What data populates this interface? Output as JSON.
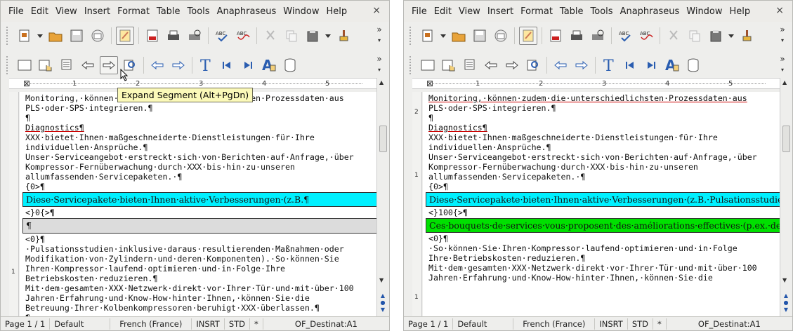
{
  "menu": [
    "File",
    "Edit",
    "View",
    "Insert",
    "Format",
    "Table",
    "Tools",
    "Anaphraseus",
    "Window",
    "Help"
  ],
  "close_glyph": "×",
  "toolbar1_icons": [
    "document-icon",
    "open-folder-icon",
    "save-icon",
    "email-icon",
    "edit-mode-icon",
    "export-pdf-icon",
    "print-icon",
    "print-preview-icon",
    "spellcheck-icon",
    "autospellcheck-icon",
    "cut-icon",
    "copy-icon",
    "paste-icon",
    "format-paintbrush-icon"
  ],
  "toolbar2_icons": [
    "setup-icon",
    "translate-segment-icon",
    "glossary-icon",
    "close-segment-icon",
    "expand-segment-icon",
    "search-icon",
    "prev-icon",
    "next-icon",
    "text-tool-icon",
    "first-segment-icon",
    "last-segment-icon",
    "concordance-icon",
    "database-icon"
  ],
  "tooltip": "Expand Segment (Alt+PgDn)",
  "ruler_numbers": [
    "1",
    "2",
    "3",
    "4",
    "5"
  ],
  "vruler_numbers_w1": [
    "1"
  ],
  "vruler_numbers_w2": [
    "2",
    "1",
    "1"
  ],
  "window1": {
    "pre": [
      "Monitoring,·können·zudem·die·unterschiedlichsten·Prozessdaten·aus",
      "PLS·oder·SPS·integrieren.¶",
      "¶",
      "Diagnostics¶",
      "XXX·bietet·Ihnen·maßgeschneiderte·Dienstleistungen·für·Ihre",
      "individuellen·Ansprüche.¶",
      "Unser·Serviceangebot·erstreckt·sich·von·Berichten·auf·Anfrage,·über",
      "Kompressor-Fernüberwachung·durch·XXX·bis·hin·zu·unseren",
      "allumfassenden·Servicepaketen.·¶",
      "{0>¶"
    ],
    "source_segment": "Diese·Servicepakete·bieten·Ihnen·aktive·Verbesserungen·(z.B.¶",
    "mid": "<}0{>¶",
    "target_segment": "¶",
    "post": [
      "<0}¶",
      "·Pulsationsstudien·inklusive·daraus·resultierenden·Maßnahmen·oder",
      "Modifikation·von·Zylindern·und·deren·Komponenten).·So·können·Sie",
      "Ihren·Kompressor·laufend·optimieren·und·in·Folge·Ihre",
      "Betriebskosten·reduzieren.¶",
      "Mit·dem·gesamten·XXX·Netzwerk·direkt·vor·Ihrer·Tür·und·mit·über·100",
      "Jahren·Erfahrung·und·Know-How·hinter·Ihnen,·können·Sie·die",
      "Betreuung·Ihrer·Kolbenkompressoren·beruhigt·XXX·überlassen.¶",
      "¶"
    ]
  },
  "window2": {
    "pre": [
      "Monitoring,·können·zudem·die·unterschiedlichsten·Prozessdaten·aus",
      "PLS·oder·SPS·integrieren.¶",
      "¶",
      "Diagnostics¶",
      "XXX·bietet·Ihnen·maßgeschneiderte·Dienstleistungen·für·Ihre",
      "individuellen·Ansprüche.¶",
      "Unser·Serviceangebot·erstreckt·sich·von·Berichten·auf·Anfrage,·über",
      "Kompressor-Fernüberwachung·durch·XXX·bis·hin·zu·unseren",
      "allumfassenden·Servicepaketen.·¶",
      "{0>¶"
    ],
    "source_segment": "Diese·Servicepakete·bieten·Ihnen·aktive·Verbesserungen·(z.B.·Pulsationsstudien·inklusive·daraus·resultierenden·Maßnahmen·oder·Modifikation·von·Zylindern·und·deren·Komponenten).¶",
    "mid": "<}100{>¶",
    "target_segment": "Ces·bouquets·de·services·vous·proposent·des·améliorations·effectives·(p.ex.·des·études·de·pulsations·suivies·d'actions·concrètes·ou·de·modifications·de·cylindres·et·de·leurs·composants)¶",
    "post": [
      "<0}¶",
      "·So·können·Sie·Ihren·Kompressor·laufend·optimieren·und·in·Folge",
      "Ihre·Betriebskosten·reduzieren.¶",
      "Mit·dem·gesamten·XXX·Netzwerk·direkt·vor·Ihrer·Tür·und·mit·über·100",
      "Jahren·Erfahrung·und·Know-How·hinter·Ihnen,·können·Sie·die"
    ]
  },
  "status": {
    "page": "Page 1 / 1",
    "style": "Default",
    "language": "French (France)",
    "insert": "INSRT",
    "selection": "STD",
    "modified": "*",
    "section": "OF_Destinat:A1"
  },
  "colors": {
    "source_segment": "#00f0ff",
    "target_segment_filled": "#00e000",
    "target_segment_empty": "#dcdcdc",
    "tooltip_bg": "#fbf9b9"
  }
}
